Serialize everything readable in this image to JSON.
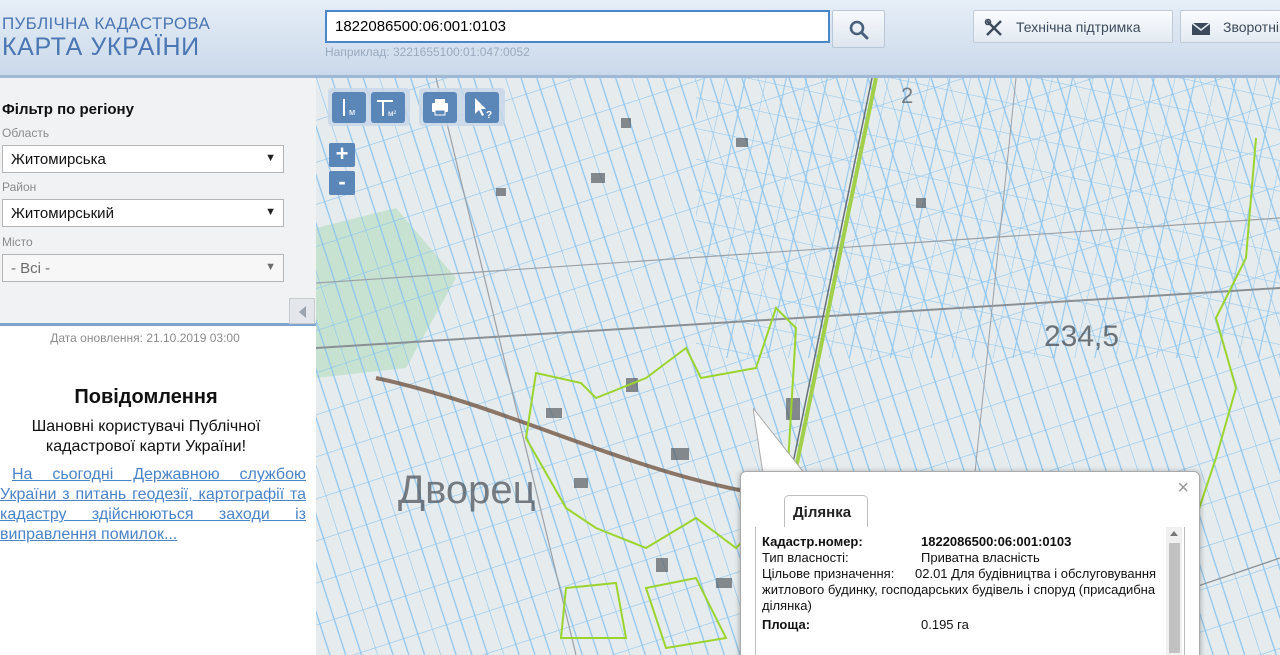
{
  "header": {
    "logo_line1": "ПУБЛІЧНА КАДАСТРОВА",
    "logo_line2": "КАРТА УКРАЇНИ",
    "search_value": "1822086500:06:001:0103",
    "example": "Наприклад: 3221655100:01:047:0052",
    "support_label": "Технічна підтримка",
    "feedback_label": "Зворотній зв'язок"
  },
  "filter": {
    "title": "Фільтр по регіону",
    "region_label": "Область",
    "region_value": "Житомирська",
    "district_label": "Район",
    "district_value": "Житомирський",
    "city_label": "Місто",
    "city_value": "- Всі -"
  },
  "sidebar": {
    "update_date": "Дата оновлення: 21.10.2019 03:00",
    "notice_title": "Повідомлення",
    "notice_text": "Шановні користувачі Публічної кадастрової карти України!",
    "notice_link": "На сьогодні Державною службою України з питань геодезії, картографії та кадастру здійснюються заходи із виправлення помилок..."
  },
  "map": {
    "zoom_in": "+",
    "zoom_out": "-",
    "label_elevation": "234,5",
    "label_village": "Дворец",
    "label_2": "2"
  },
  "popup": {
    "tab_label": "Ділянка",
    "close": "×",
    "rows": [
      {
        "key": "Кадастр.номер:",
        "value": "1822086500:06:001:0103"
      },
      {
        "key": "Тип власності:",
        "value": "Приватна власність"
      },
      {
        "key": "Цільове призначення:",
        "value": "02.01 Для будівництва і обслуговування житлового будинку, господарських будівель і споруд (присадибна ділянка)"
      },
      {
        "key": "Площа:",
        "value": "0.195 га"
      }
    ]
  },
  "colors": {
    "brand": "#4a76b3",
    "parcel_lines": "#8ec5ee",
    "highlight": "#9bd42e"
  }
}
